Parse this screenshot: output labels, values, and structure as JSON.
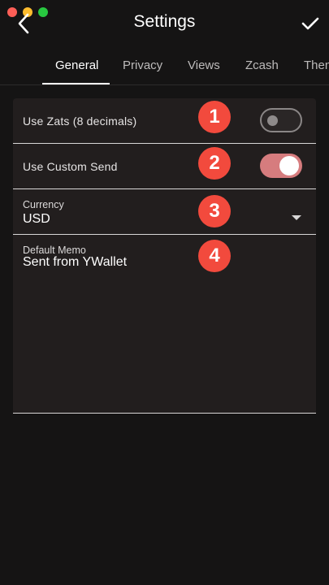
{
  "header": {
    "title": "Settings"
  },
  "tabs": [
    {
      "label": "General",
      "active": true
    },
    {
      "label": "Privacy",
      "active": false
    },
    {
      "label": "Views",
      "active": false
    },
    {
      "label": "Zcash",
      "active": false
    },
    {
      "label": "Then",
      "active": false
    }
  ],
  "settings": {
    "use_zats": {
      "label": "Use Zats (8 decimals)",
      "enabled": false,
      "badge": "1"
    },
    "custom_send": {
      "label": "Use Custom Send",
      "enabled": true,
      "badge": "2"
    },
    "currency": {
      "label": "Currency",
      "value": "USD",
      "badge": "3"
    },
    "memo": {
      "label": "Default Memo",
      "value": "Sent from YWallet",
      "badge": "4"
    }
  },
  "colors": {
    "background": "#151414",
    "panel": "#221e1e",
    "badge": "#f24a3d",
    "toggle_on": "#d67c7e"
  }
}
